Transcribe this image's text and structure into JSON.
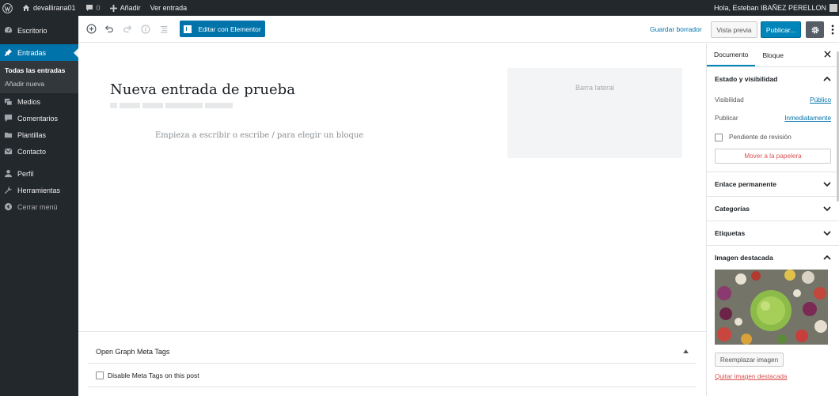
{
  "adminbar": {
    "site_name": "devallirana01",
    "comments_count": "0",
    "add_new": "Añadir",
    "view_post": "Ver entrada",
    "greeting": "Hola, Esteban IBAÑEZ PERELLON"
  },
  "menu": {
    "items": [
      {
        "label": "Escritorio",
        "icon": "dashboard-icon"
      },
      {
        "label": "Entradas",
        "icon": "pin-icon"
      },
      {
        "label": "Medios",
        "icon": "media-icon"
      },
      {
        "label": "Comentarios",
        "icon": "comment-icon"
      },
      {
        "label": "Plantillas",
        "icon": "folder-icon"
      },
      {
        "label": "Contacto",
        "icon": "mail-icon"
      },
      {
        "label": "Perfil",
        "icon": "user-icon"
      },
      {
        "label": "Herramientas",
        "icon": "wrench-icon"
      },
      {
        "label": "Cerrar menú",
        "icon": "collapse-icon"
      }
    ],
    "submenu": [
      "Todas las entradas",
      "Añadir nueva"
    ]
  },
  "toolbar": {
    "elementor_label": "Editar con Elementor",
    "save_draft": "Guardar borrador",
    "preview": "Vista previa",
    "publish": "Publicar..."
  },
  "editor": {
    "title": "Nueva entrada de prueba",
    "block_placeholder": "Empieza a escribir o escribe / para elegir un bloque",
    "sidebar_region": "Barra lateral"
  },
  "metabox": {
    "title": "Open Graph Meta Tags",
    "disable_label": "Disable Meta Tags on this post"
  },
  "panel": {
    "tabs": [
      "Documento",
      "Bloque"
    ],
    "status_title": "Estado y visibilidad",
    "visibility_label": "Visibilidad",
    "visibility_value": "Público",
    "publish_label": "Publicar",
    "publish_value": "Inmediatamente",
    "pending_label": "Pendiente de revisión",
    "trash_label": "Mover a la papelera",
    "permalink_title": "Enlace permanente",
    "categories_title": "Categorías",
    "tags_title": "Etiquetas",
    "featured_title": "Imagen destacada",
    "replace_label": "Reemplazar imagen",
    "remove_label": "Quitar imagen destacada"
  },
  "colors": {
    "admin_dark": "#23282d",
    "accent": "#0073aa",
    "danger": "#d94f4f"
  }
}
